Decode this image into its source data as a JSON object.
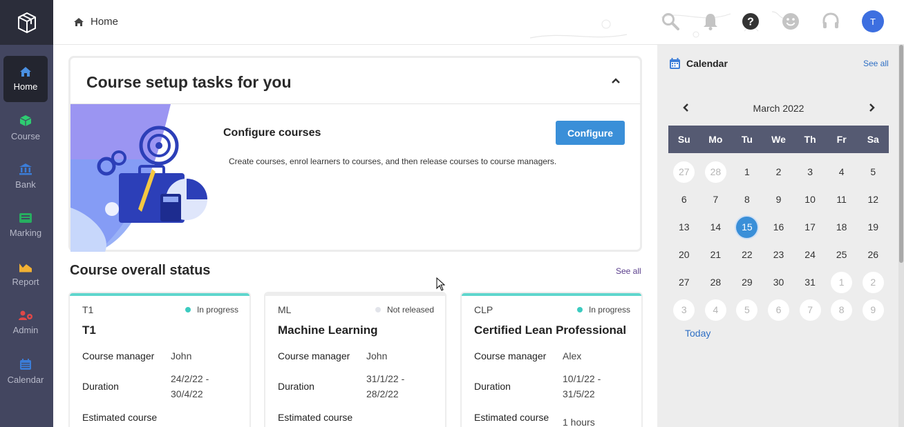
{
  "header": {
    "breadcrumb": "Home",
    "avatar_initial": "T"
  },
  "sidebar": {
    "items": [
      {
        "label": "Home",
        "icon": "home-icon",
        "color": "#4a90e2"
      },
      {
        "label": "Course",
        "icon": "cube-icon",
        "color": "#2ecc71"
      },
      {
        "label": "Bank",
        "icon": "bank-icon",
        "color": "#3b7dd8"
      },
      {
        "label": "Marking",
        "icon": "marking-icon",
        "color": "#27ae60"
      },
      {
        "label": "Report",
        "icon": "chart-icon",
        "color": "#f2b134"
      },
      {
        "label": "Admin",
        "icon": "users-gear-icon",
        "color": "#e04848"
      },
      {
        "label": "Calendar",
        "icon": "calendar-icon",
        "color": "#3b7dd8"
      }
    ]
  },
  "setup": {
    "title": "Course setup tasks for you",
    "task_title": "Configure courses",
    "button": "Configure",
    "description": "Create courses, enrol learners to courses, and then release courses to course managers."
  },
  "status": {
    "title": "Course overall status",
    "see_all": "See all",
    "cards": [
      {
        "code": "T1",
        "status": "In progress",
        "status_color": "#3ccbc0",
        "name": "T1",
        "manager_label": "Course manager",
        "manager": "John",
        "duration_label": "Duration",
        "duration_from": "24/2/22 -",
        "duration_to": "30/4/22",
        "estimated_label": "Estimated course",
        "estimated": ""
      },
      {
        "code": "ML",
        "status": "Not released",
        "status_color": "#e2e4ea",
        "name": "Machine Learning",
        "manager_label": "Course manager",
        "manager": "John",
        "duration_label": "Duration",
        "duration_from": "31/1/22 -",
        "duration_to": "28/2/22",
        "estimated_label": "Estimated course",
        "estimated": ""
      },
      {
        "code": "CLP",
        "status": "In progress",
        "status_color": "#3ccbc0",
        "name": "Certified Lean Professional",
        "manager_label": "Course manager",
        "manager": "Alex",
        "duration_label": "Duration",
        "duration_from": "10/1/22 -",
        "duration_to": "31/5/22",
        "estimated_label": "Estimated course",
        "estimated": "1 hours"
      }
    ]
  },
  "calendar": {
    "title": "Calendar",
    "see_all": "See all",
    "month": "March 2022",
    "today": "Today",
    "weekdays": [
      "Su",
      "Mo",
      "Tu",
      "We",
      "Th",
      "Fr",
      "Sa"
    ],
    "weeks": [
      [
        "27",
        "28",
        "1",
        "2",
        "3",
        "4",
        "5"
      ],
      [
        "6",
        "7",
        "8",
        "9",
        "10",
        "11",
        "12"
      ],
      [
        "13",
        "14",
        "15",
        "16",
        "17",
        "18",
        "19"
      ],
      [
        "20",
        "21",
        "22",
        "23",
        "24",
        "25",
        "26"
      ],
      [
        "27",
        "28",
        "29",
        "30",
        "31",
        "1",
        "2"
      ],
      [
        "3",
        "4",
        "5",
        "6",
        "7",
        "8",
        "9"
      ]
    ],
    "selected": "15"
  }
}
